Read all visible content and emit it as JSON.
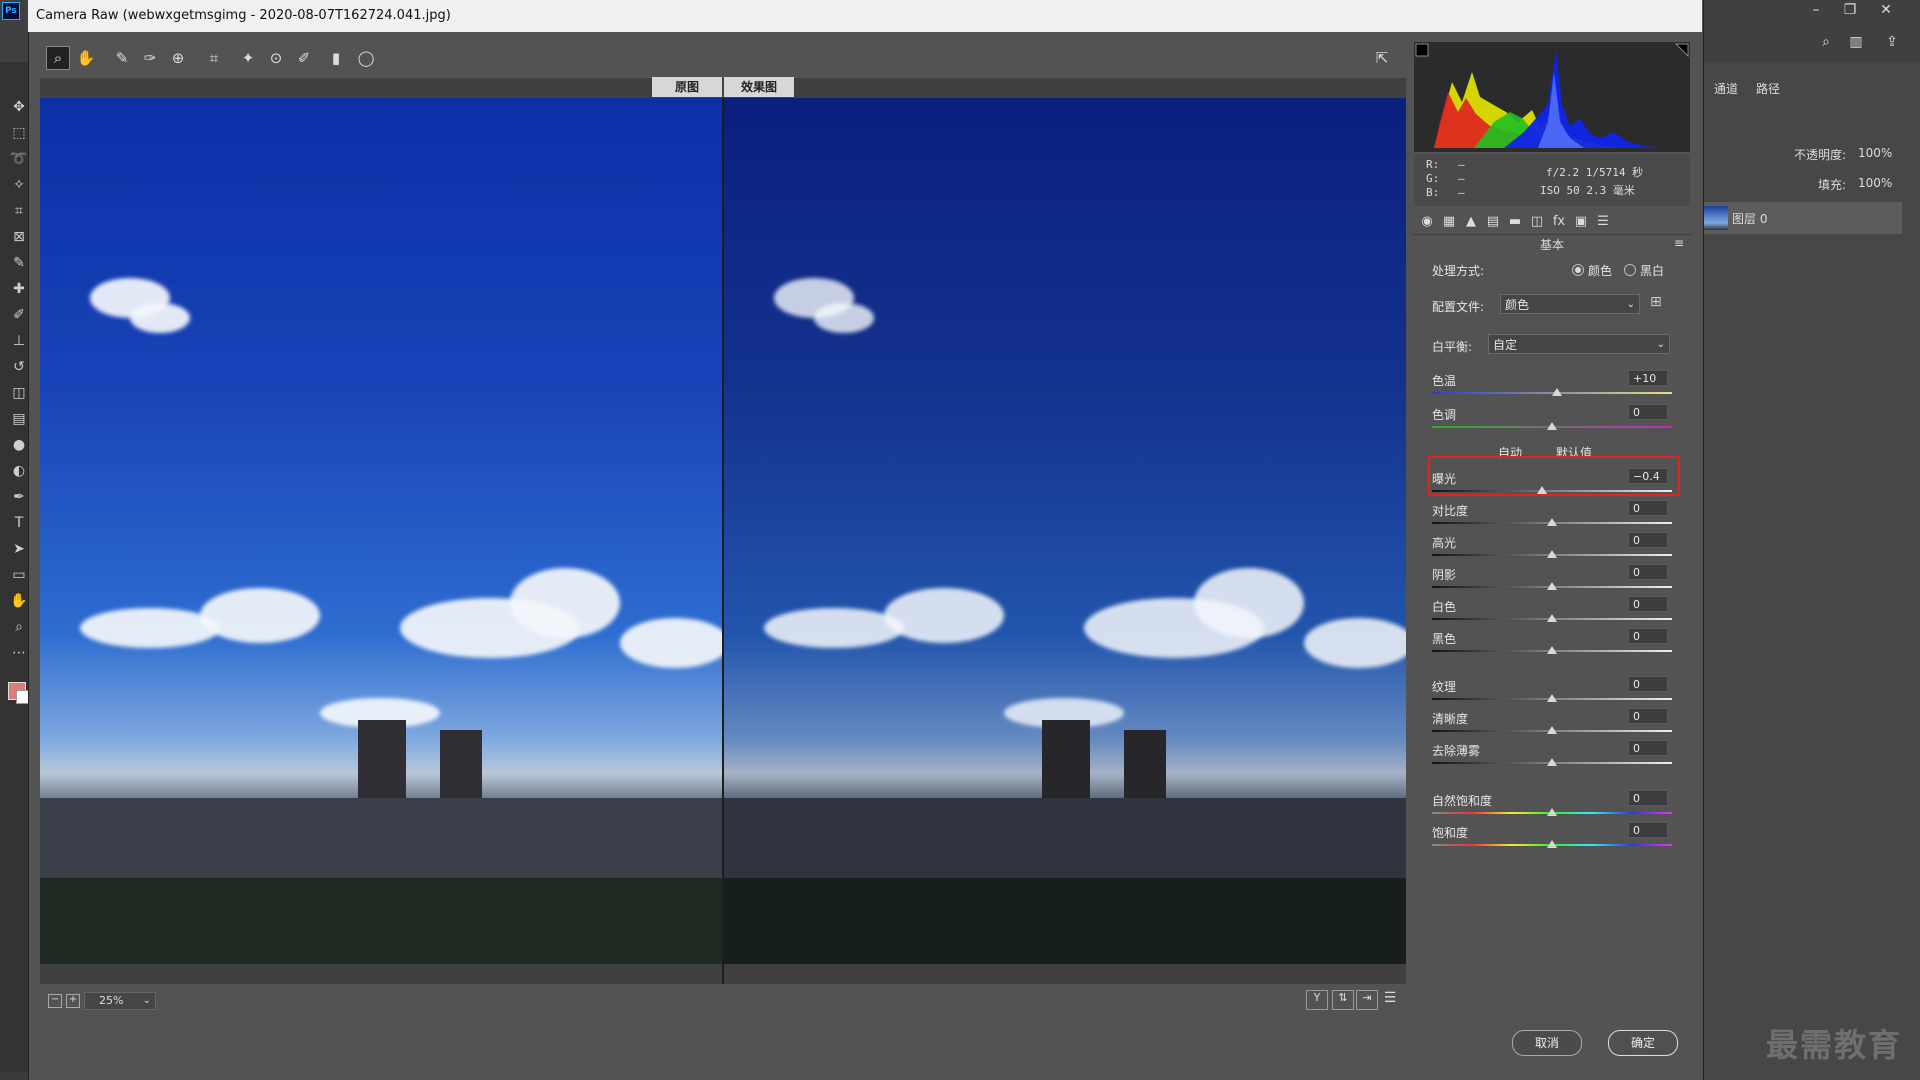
{
  "dialog": {
    "title": "Camera Raw (webwxgetmsgimg - 2020-08-07T162724.041.jpg)"
  },
  "preview": {
    "before_label": "原图",
    "after_label": "效果图",
    "zoom": "25%"
  },
  "histogram": {
    "rgb_labels": [
      "R:",
      "G:",
      "B:"
    ],
    "rgb_values": [
      "—",
      "—",
      "—"
    ],
    "camera_line1": "f/2.2  1/5714 秒",
    "camera_line2": "ISO 50  2.3 毫米"
  },
  "panel": {
    "title": "基本",
    "treatment_label": "处理方式:",
    "treatment_color": "颜色",
    "treatment_bw": "黑白",
    "profile_label": "配置文件:",
    "profile_value": "颜色",
    "wb_label": "白平衡:",
    "wb_value": "自定",
    "auto_label": "自动",
    "default_label": "默认值",
    "sliders": [
      {
        "label": "色温",
        "value": "+10",
        "pos": 0.52
      },
      {
        "label": "色调",
        "value": "0",
        "pos": 0.5
      },
      {
        "label": "曝光",
        "value": "−0.4",
        "pos": 0.46
      },
      {
        "label": "对比度",
        "value": "0",
        "pos": 0.5
      },
      {
        "label": "高光",
        "value": "0",
        "pos": 0.5
      },
      {
        "label": "阴影",
        "value": "0",
        "pos": 0.5
      },
      {
        "label": "白色",
        "value": "0",
        "pos": 0.5
      },
      {
        "label": "黑色",
        "value": "0",
        "pos": 0.5
      },
      {
        "label": "纹理",
        "value": "0",
        "pos": 0.5
      },
      {
        "label": "清晰度",
        "value": "0",
        "pos": 0.5
      },
      {
        "label": "去除薄雾",
        "value": "0",
        "pos": 0.5
      },
      {
        "label": "自然饱和度",
        "value": "0",
        "pos": 0.5
      },
      {
        "label": "饱和度",
        "value": "0",
        "pos": 0.5
      }
    ]
  },
  "buttons": {
    "cancel": "取消",
    "ok": "确定"
  },
  "ps_right": {
    "tab_channels": "通道",
    "tab_paths": "路径",
    "opacity_label": "不透明度:",
    "opacity_value": "100%",
    "fill_label": "填充:",
    "fill_value": "100%",
    "layer_name": "图层 0"
  },
  "watermark": "最需教育"
}
